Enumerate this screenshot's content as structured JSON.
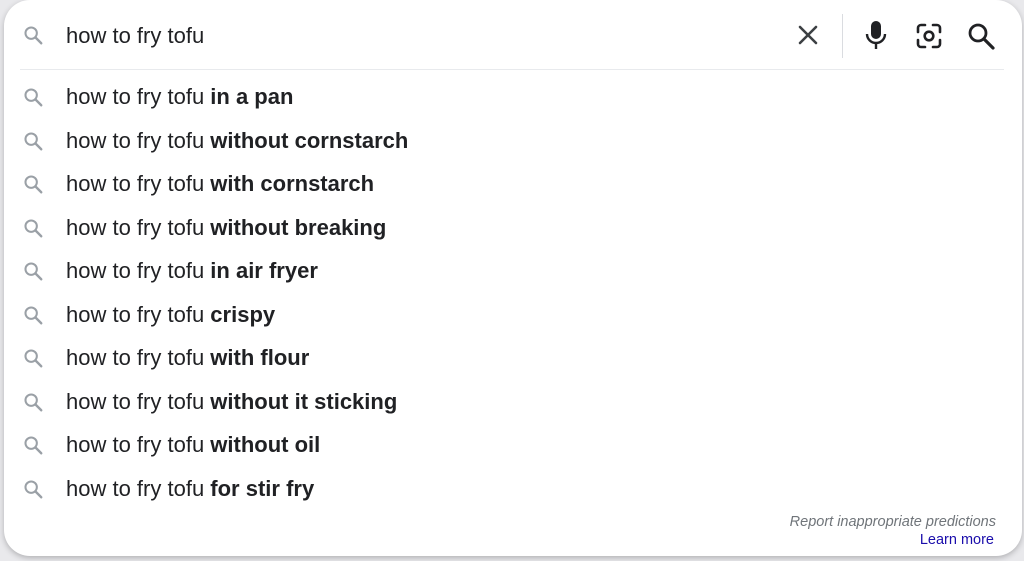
{
  "search": {
    "query": "how to fry tofu",
    "clear_icon": "close-icon",
    "voice_icon": "microphone-icon",
    "lens_icon": "camera-lens-icon",
    "submit_icon": "search-icon"
  },
  "suggestions": [
    {
      "prefix": "how to fry tofu ",
      "completion": "in a pan"
    },
    {
      "prefix": "how to fry tofu ",
      "completion": "without cornstarch"
    },
    {
      "prefix": "how to fry tofu ",
      "completion": "with cornstarch"
    },
    {
      "prefix": "how to fry tofu ",
      "completion": "without breaking"
    },
    {
      "prefix": "how to fry tofu ",
      "completion": "in air fryer"
    },
    {
      "prefix": "how to fry tofu ",
      "completion": "crispy"
    },
    {
      "prefix": "how to fry tofu ",
      "completion": "with flour"
    },
    {
      "prefix": "how to fry tofu ",
      "completion": "without it sticking"
    },
    {
      "prefix": "how to fry tofu ",
      "completion": "without oil"
    },
    {
      "prefix": "how to fry tofu ",
      "completion": "for stir fry"
    }
  ],
  "footer": {
    "report_text": "Report inappropriate predictions",
    "learn_more": "Learn more"
  },
  "colors": {
    "text": "#202124",
    "icon_gray": "#9aa0a6",
    "link": "#1a0dab",
    "mic_blue": "#4285f4"
  }
}
